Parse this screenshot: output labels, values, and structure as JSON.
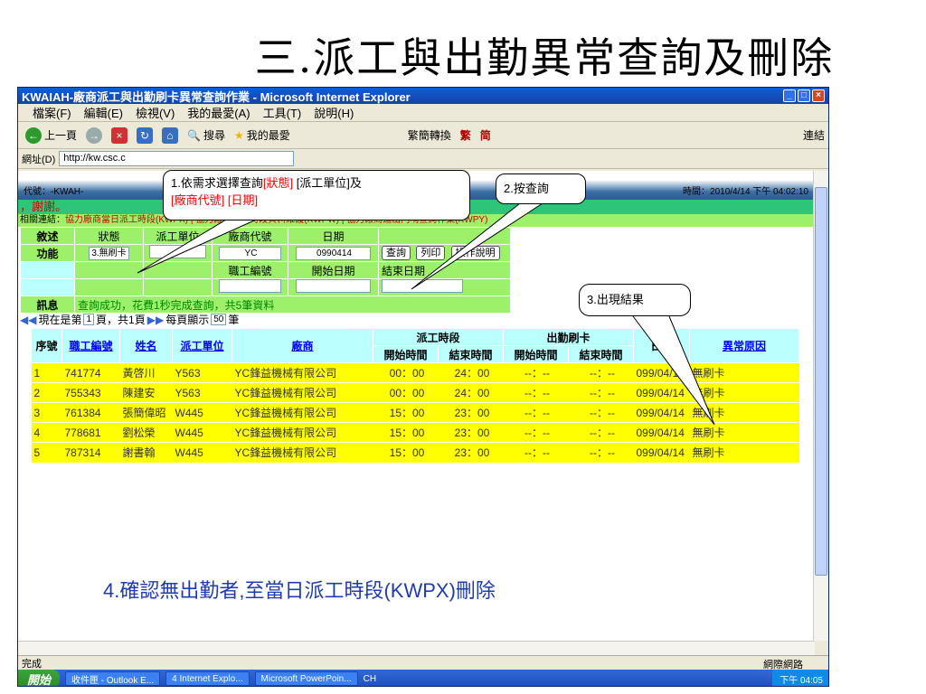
{
  "slide": {
    "title": "三.派工與出勤異常查詢及刪除",
    "note4": "4.確認無出勤者,至當日派工時段(KWPX)刪除"
  },
  "browser": {
    "title": "KWAIAH-廠商派工與出勤刷卡異常查詢作業 - Microsoft Internet Explorer",
    "menu": [
      "檔案(F)",
      "編輯(E)",
      "檢視(V)",
      "我的最愛(A)",
      "工具(T)",
      "說明(H)"
    ],
    "toolbar": {
      "back": "上一頁",
      "search": "搜尋",
      "favorites": "我的最愛",
      "convert": "繁簡轉換",
      "trad": "繁",
      "simp": "简",
      "connect": "連結"
    },
    "address_label": "網址(D)",
    "address_value": "http://kw.csc.c",
    "status": "完成",
    "zone": "網際網路"
  },
  "page": {
    "code_label": "代號：-KWAH-",
    "time_label": "時間：2010/4/14 下午 04:02:10",
    "thanks": "，謝謝。",
    "links_label": "相關連結：",
    "links_text": "協力廠商當日派工時段(KWPX) | 協力廠商派工時段資料維護(KWPW) | 協力廠商進出門哨查詢作業(KWPY)",
    "form": {
      "row1": [
        "敘述",
        "狀態",
        "派工單位",
        "廠商代號",
        "日期"
      ],
      "func_label": "功能",
      "status_value": "3.無刷卡",
      "vendor_value": "YC",
      "date_value": "0990414",
      "btn_query": "查詢",
      "btn_print": "列印",
      "btn_help": "操作說明",
      "row3": [
        "職工編號",
        "開始日期",
        "結束日期"
      ],
      "msg_label": "訊息",
      "msg_text": "查詢成功，花費1秒完成查詢，共5筆資料"
    },
    "pager": {
      "pre": "現在是第",
      "page": "1",
      "mid": "頁，共1頁",
      "per_pre": "每頁顯示",
      "per": "50",
      "per_post": "筆"
    },
    "table": {
      "headers": {
        "seq": "序號",
        "emp": "職工編號",
        "name": "姓名",
        "unit": "派工單位",
        "vendor": "廠商",
        "period": "派工時段",
        "attend": "出勤刷卡",
        "date": "日期",
        "reason": "異常原因",
        "start": "開始時間",
        "end": "結束時間"
      },
      "rows": [
        {
          "seq": "1",
          "emp": "741774",
          "name": "黃啓川",
          "unit": "Y563",
          "vendor": "YC鋒益機械有限公司",
          "ps": "00：00",
          "pe": "24：00",
          "as": "--：--",
          "ae": "--：--",
          "date": "099/04/14",
          "reason": "無刷卡"
        },
        {
          "seq": "2",
          "emp": "755343",
          "name": "陳建安",
          "unit": "Y563",
          "vendor": "YC鋒益機械有限公司",
          "ps": "00：00",
          "pe": "24：00",
          "as": "--：--",
          "ae": "--：--",
          "date": "099/04/14",
          "reason": "無刷卡"
        },
        {
          "seq": "3",
          "emp": "761384",
          "name": "張簡偉昭",
          "unit": "W445",
          "vendor": "YC鋒益機械有限公司",
          "ps": "15：00",
          "pe": "23：00",
          "as": "--：--",
          "ae": "--：--",
          "date": "099/04/14",
          "reason": "無刷卡"
        },
        {
          "seq": "4",
          "emp": "778681",
          "name": "劉松榮",
          "unit": "W445",
          "vendor": "YC鋒益機械有限公司",
          "ps": "15：00",
          "pe": "23：00",
          "as": "--：--",
          "ae": "--：--",
          "date": "099/04/14",
          "reason": "無刷卡"
        },
        {
          "seq": "5",
          "emp": "787314",
          "name": "謝書翰",
          "unit": "W445",
          "vendor": "YC鋒益機械有限公司",
          "ps": "15：00",
          "pe": "23：00",
          "as": "--：--",
          "ae": "--：--",
          "date": "099/04/14",
          "reason": "無刷卡"
        }
      ]
    }
  },
  "callouts": {
    "c1_a": "1.依需求選擇查詢",
    "c1_b": "[狀態]",
    "c1_c": " [派工單位]及",
    "c1_d": "[廠商代號] [日期]",
    "c2": "2.按查詢",
    "c3": "3.出現結果"
  },
  "taskbar": {
    "start": "開始",
    "tasks": [
      "收件匣 - Outlook E...",
      "4 Internet Explo...",
      "Microsoft PowerPoin..."
    ],
    "ime": "CH",
    "clock": "下午 04:05"
  }
}
